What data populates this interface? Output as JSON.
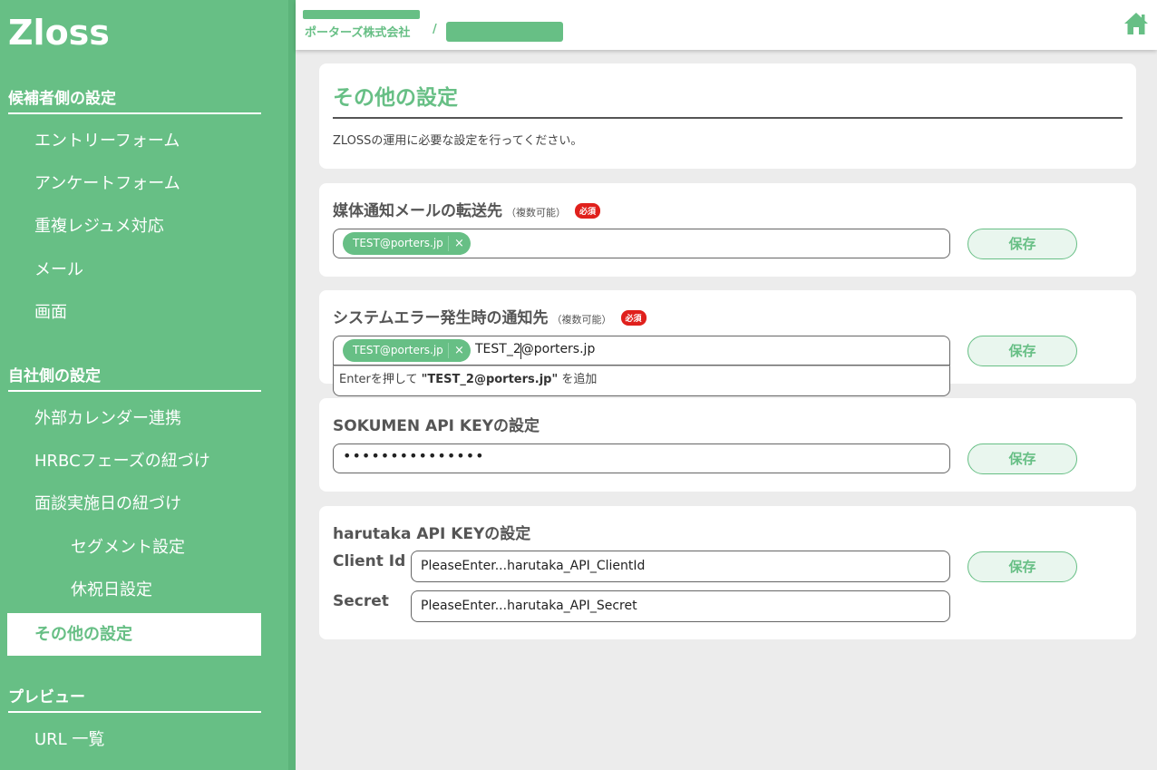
{
  "app": {
    "logo": "Zloss"
  },
  "sidebar": {
    "section_candidate": "候補者側の設定",
    "candidate_items": [
      {
        "label": "エントリーフォーム"
      },
      {
        "label": "アンケートフォーム"
      },
      {
        "label": "重複レジュメ対応"
      },
      {
        "label": "メール"
      },
      {
        "label": "画面"
      }
    ],
    "section_company": "自社側の設定",
    "company_items": [
      {
        "label": "外部カレンダー連携"
      },
      {
        "label": "HRBCフェーズの紐づけ"
      },
      {
        "label": "面談実施日の紐づけ"
      },
      {
        "label": "セグメント設定"
      },
      {
        "label": "休祝日設定"
      },
      {
        "label": "その他の設定"
      }
    ],
    "section_preview": "プレビュー",
    "preview_items": [
      {
        "label": "URL 一覧"
      }
    ],
    "active_item": "その他の設定"
  },
  "header": {
    "company": "ポーターズ株式会社",
    "separator": "/",
    "home_icon": "home-icon"
  },
  "page": {
    "title": "その他の設定",
    "description": "ZLOSSの運用に必要な設定を行ってください。"
  },
  "media_forward": {
    "heading": "媒体通知メールの転送先",
    "note": "（複数可能）",
    "required": "必須",
    "chips": [
      "TEST@porters.jp"
    ],
    "remove_icon": "×",
    "save_label": "保存"
  },
  "system_error": {
    "heading": "システムエラー発生時の通知先",
    "note": "（複数可能）",
    "required": "必須",
    "chips": [
      "TEST@porters.jp"
    ],
    "remove_icon": "×",
    "typed_value": "TEST_2@porters.jp",
    "suggestion_prefix": "Enterを押して ",
    "suggestion_value": "\"TEST_2@porters.jp\"",
    "suggestion_suffix": " を追加",
    "save_label": "保存"
  },
  "sokumen": {
    "heading": "SOKUMEN API KEYの設定",
    "masked_value": "•••••••••••••••",
    "save_label": "保存"
  },
  "harutaka": {
    "heading": "harutaka API KEYの設定",
    "client_id_label": "Client Id",
    "client_id_value": "PleaseEnter...harutaka_API_ClientId",
    "secret_label": "Secret",
    "secret_value": "PleaseEnter...harutaka_API_Secret",
    "save_label": "保存"
  },
  "colors": {
    "brand_green": "#67bf85",
    "required_red": "#e0201c",
    "background": "#ececec"
  }
}
